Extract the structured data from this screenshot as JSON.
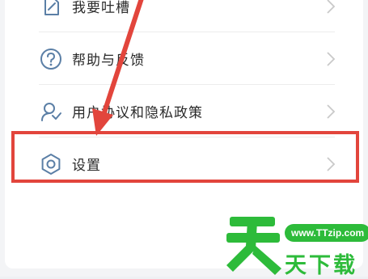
{
  "menu": {
    "items": [
      {
        "label": "我要吐槽",
        "icon": "edit-icon"
      },
      {
        "label": "帮助与反馈",
        "icon": "help-icon"
      },
      {
        "label": "用户协议和隐私政策",
        "icon": "agreement-icon"
      },
      {
        "label": "设置",
        "icon": "settings-icon"
      }
    ]
  },
  "annotation": {
    "highlight_color": "#e2453c",
    "highlighted_item": "设置"
  },
  "watermark": {
    "url": "www.TTzip.com",
    "name": "天下载",
    "color": "#2dbb3a"
  },
  "colors": {
    "icon": "#5b7fa6",
    "chevron": "#c9c9c9",
    "text": "#2a2a2a"
  }
}
